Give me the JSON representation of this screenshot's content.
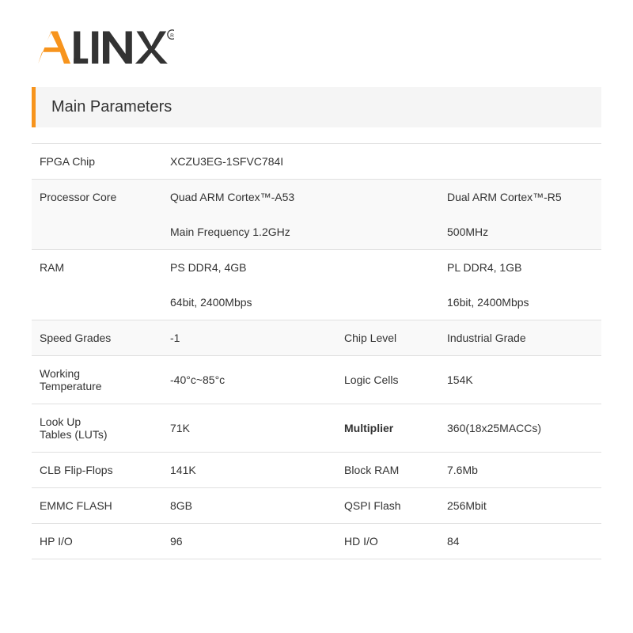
{
  "logo": {
    "alt": "ALINX Logo"
  },
  "section": {
    "title": "Main Parameters"
  },
  "rows": [
    {
      "type": "single",
      "shaded": false,
      "label": "FPGA Chip",
      "val1": "XCZU3EG-1SFVC784I",
      "label2": "",
      "val2": ""
    },
    {
      "type": "multi",
      "shaded": true,
      "label": "Processor Core",
      "sub": [
        {
          "val1": "Quad ARM Cortex™-A53",
          "label2": "",
          "val2": "Dual ARM Cortex™-R5"
        },
        {
          "val1": "Main Frequency 1.2GHz",
          "label2": "",
          "val2": "500MHz"
        }
      ]
    },
    {
      "type": "multi",
      "shaded": false,
      "label": "RAM",
      "sub": [
        {
          "val1": "PS DDR4, 4GB",
          "label2": "",
          "val2": "PL DDR4, 1GB"
        },
        {
          "val1": "64bit, 2400Mbps",
          "label2": "",
          "val2": "16bit, 2400Mbps"
        }
      ]
    },
    {
      "type": "single",
      "shaded": true,
      "label": "Speed Grades",
      "val1": "-1",
      "label2": "Chip Level",
      "val2": "Industrial Grade"
    },
    {
      "type": "single",
      "shaded": false,
      "label": "Working\nTemperature",
      "val1": "-40°c~85°c",
      "label2": "Logic Cells",
      "val2": "154K"
    },
    {
      "type": "single",
      "shaded": false,
      "label": "Look Up\nTables (LUTs)",
      "val1": "71K",
      "label2": "Multiplier",
      "val2": "360(18x25MACCs)",
      "label2_bold": true
    },
    {
      "type": "single",
      "shaded": false,
      "label": "CLB Flip-Flops",
      "val1": "141K",
      "label2": "Block RAM",
      "val2": "7.6Mb"
    },
    {
      "type": "single",
      "shaded": false,
      "label": "EMMC FLASH",
      "val1": "8GB",
      "label2": "QSPI Flash",
      "val2": "256Mbit"
    },
    {
      "type": "single",
      "shaded": false,
      "label": "HP I/O",
      "val1": "96",
      "label2": "HD I/O",
      "val2": "84"
    }
  ]
}
